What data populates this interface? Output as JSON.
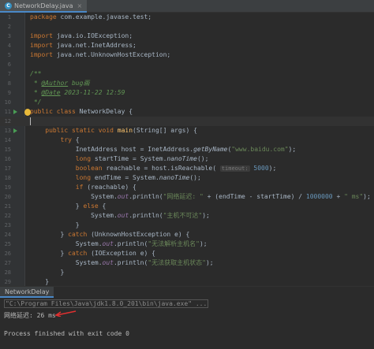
{
  "tab": {
    "label": "NetworkDelay.java",
    "icon": "java-class-icon"
  },
  "lines": [
    {
      "n": "1",
      "parts": [
        [
          "k",
          "package "
        ],
        [
          "p",
          "com.example.javase.test;"
        ]
      ]
    },
    {
      "n": "2",
      "parts": []
    },
    {
      "n": "3",
      "parts": [
        [
          "k",
          "import "
        ],
        [
          "p",
          "java.io.IOException;"
        ]
      ]
    },
    {
      "n": "4",
      "parts": [
        [
          "k",
          "import "
        ],
        [
          "p",
          "java.net.InetAddress;"
        ]
      ]
    },
    {
      "n": "5",
      "parts": [
        [
          "k",
          "import "
        ],
        [
          "p",
          "java.net.UnknownHostException;"
        ]
      ]
    },
    {
      "n": "6",
      "parts": []
    },
    {
      "n": "7",
      "parts": [
        [
          "cm",
          "/**"
        ]
      ]
    },
    {
      "n": "8",
      "parts": [
        [
          "cm",
          " * "
        ],
        [
          "tag",
          "@Author"
        ],
        [
          "cm",
          " bug画"
        ]
      ]
    },
    {
      "n": "9",
      "parts": [
        [
          "cm",
          " * "
        ],
        [
          "tag",
          "@Date"
        ],
        [
          "cm",
          " 2023-11-22 12:59"
        ]
      ]
    },
    {
      "n": "10",
      "parts": [
        [
          "cm",
          " */"
        ]
      ]
    },
    {
      "n": "11",
      "parts": [
        [
          "k",
          "public class "
        ],
        [
          "p",
          "NetworkDelay {"
        ]
      ]
    },
    {
      "n": "12",
      "parts": []
    },
    {
      "n": "13",
      "parts": [
        [
          "p",
          "    "
        ],
        [
          "k",
          "public static void "
        ],
        [
          "f",
          "main"
        ],
        [
          "p",
          "(String[] args) {"
        ]
      ]
    },
    {
      "n": "14",
      "parts": [
        [
          "p",
          "        "
        ],
        [
          "k",
          "try "
        ],
        [
          "p",
          "{"
        ]
      ]
    },
    {
      "n": "15",
      "parts": [
        [
          "p",
          "            InetAddress host = InetAddress."
        ],
        [
          "it",
          "getByName"
        ],
        [
          "p",
          "("
        ],
        [
          "s",
          "\"www.baidu.com\""
        ],
        [
          "p",
          ");"
        ]
      ]
    },
    {
      "n": "16",
      "parts": [
        [
          "p",
          "            "
        ],
        [
          "k",
          "long "
        ],
        [
          "p",
          "startTime = System."
        ],
        [
          "it",
          "nanoTime"
        ],
        [
          "p",
          "();"
        ]
      ]
    },
    {
      "n": "17",
      "parts": [
        [
          "p",
          "            "
        ],
        [
          "k",
          "boolean "
        ],
        [
          "p",
          "reachable = host.isReachable( "
        ],
        [
          "hint",
          "timeout:"
        ],
        [
          "p",
          " "
        ],
        [
          "n",
          "5000"
        ],
        [
          "p",
          ");"
        ]
      ]
    },
    {
      "n": "18",
      "parts": [
        [
          "p",
          "            "
        ],
        [
          "k",
          "long "
        ],
        [
          "p",
          "endTime = System."
        ],
        [
          "it",
          "nanoTime"
        ],
        [
          "p",
          "();"
        ]
      ]
    },
    {
      "n": "19",
      "parts": [
        [
          "p",
          "            "
        ],
        [
          "k",
          "if "
        ],
        [
          "p",
          "(reachable) {"
        ]
      ]
    },
    {
      "n": "20",
      "parts": [
        [
          "p",
          "                System."
        ],
        [
          "st",
          "out"
        ],
        [
          "p",
          ".println("
        ],
        [
          "s",
          "\"网络延迟: \""
        ],
        [
          "p",
          " + (endTime - startTime) / "
        ],
        [
          "n",
          "1000000"
        ],
        [
          "p",
          " + "
        ],
        [
          "s",
          "\" ms\""
        ],
        [
          "p",
          ");"
        ]
      ]
    },
    {
      "n": "21",
      "parts": [
        [
          "p",
          "            } "
        ],
        [
          "k",
          "else "
        ],
        [
          "p",
          "{"
        ]
      ]
    },
    {
      "n": "22",
      "parts": [
        [
          "p",
          "                System."
        ],
        [
          "st",
          "out"
        ],
        [
          "p",
          ".println("
        ],
        [
          "s",
          "\"主机不可达\""
        ],
        [
          "p",
          ");"
        ]
      ]
    },
    {
      "n": "23",
      "parts": [
        [
          "p",
          "            }"
        ]
      ]
    },
    {
      "n": "24",
      "parts": [
        [
          "p",
          "        } "
        ],
        [
          "k",
          "catch "
        ],
        [
          "p",
          "(UnknownHostException e) {"
        ]
      ]
    },
    {
      "n": "25",
      "parts": [
        [
          "p",
          "            System."
        ],
        [
          "st",
          "out"
        ],
        [
          "p",
          ".println("
        ],
        [
          "s",
          "\"无法解析主机名\""
        ],
        [
          "p",
          ");"
        ]
      ]
    },
    {
      "n": "26",
      "parts": [
        [
          "p",
          "        } "
        ],
        [
          "k",
          "catch "
        ],
        [
          "p",
          "(IOException e) {"
        ]
      ]
    },
    {
      "n": "27",
      "parts": [
        [
          "p",
          "            System."
        ],
        [
          "st",
          "out"
        ],
        [
          "p",
          ".println("
        ],
        [
          "s",
          "\"无法获取主机状态\""
        ],
        [
          "p",
          ");"
        ]
      ]
    },
    {
      "n": "28",
      "parts": [
        [
          "p",
          "        }"
        ]
      ]
    },
    {
      "n": "29",
      "parts": [
        [
          "p",
          "    }"
        ]
      ]
    }
  ],
  "run": {
    "tab_label": "NetworkDelay",
    "command": "\"C:\\Program Files\\Java\\jdk1.8.0_201\\bin\\java.exe\" ...",
    "output": "网络延迟: 26 ms",
    "exit": "Process finished with exit code 0"
  }
}
